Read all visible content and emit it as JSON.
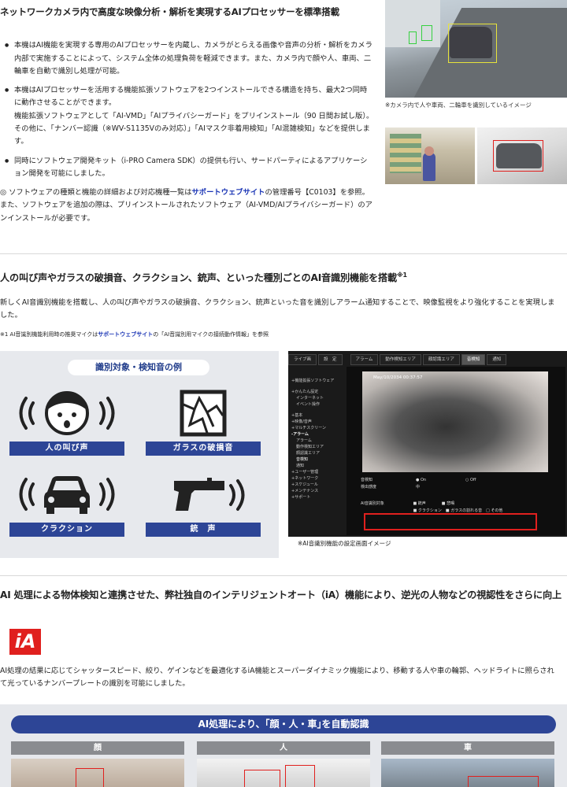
{
  "section1": {
    "title": "ネットワークカメラ内で高度な映像分析・解析を実現するAIプロセッサーを標準搭載",
    "bullets": [
      {
        "lines": [
          "本機はAI機能を実現する専用のAIプロセッサーを内蔵し、カメラがとらえる画像や音声の分析・解析をカメラ内部で実施することによって、システム全体の処理負荷を軽減できます。また、カメラ内で顔や人、車両、二輪車を自動で識別し処理が可能。"
        ]
      },
      {
        "lines": [
          "本機はAIプロセッサーを活用する機能拡張ソフトウェアを2つインストールできる構造を持ち、最大2つ同時に動作させることができます。",
          "機能拡張ソフトウェアとして「AI-VMD」「AIプライバシーガード」をプリインストール（90 日間お試し版）。",
          "その他に、「ナンバー認識（※WV-S1135Vのみ対応）」「AIマスク非着用検知」「AI混雑検知」などを提供します。"
        ]
      },
      {
        "lines": [
          "同時にソフトウェア開発キット（i-PRO Camera SDK）の提供も行い、サードパーティによるアプリケーション開発を可能にしました。"
        ]
      }
    ],
    "note_prefix": "◎ ソフトウェアの種類と機能の詳細および対応機種一覧は",
    "note_link": "サポートウェブサイト",
    "note_suffix": "の管理番号【C0103】を参照。また、ソフトウェアを追加の際は、プリインストールされたソフトウェア（AI-VMD/AIプライバシーガード）のアンインストールが必要です。",
    "photo1_caption": "※カメラ内で人や車両、二輪車を識別しているイメージ"
  },
  "section2": {
    "title": "人の叫び声やガラスの破損音、クラクション、銃声、といった種別ごとのAI音識別機能を搭載",
    "title_sup": "※1",
    "text": "新しくAI音識別機能を搭載し、人の叫び声やガラスの破損音、クラクション、銃声といった音を識別しアラーム通知することで、映像監視をより強化することを実現しました。",
    "footnote_prefix": "※1 AI音識別機能利用時の推奨マイクは",
    "footnote_link": "サポートウェブサイト",
    "footnote_suffix": "の「AI音識別用マイクの接続動作情報」を参照",
    "panel_title": "識別対象・検知音の例",
    "sounds": [
      {
        "label": "人の叫び声",
        "icon": "screaming-face-icon"
      },
      {
        "label": "ガラスの破損音",
        "icon": "broken-glass-icon"
      },
      {
        "label": "クラクション",
        "icon": "car-horn-icon"
      },
      {
        "label": "銃　声",
        "icon": "gunshot-icon"
      }
    ],
    "ui": {
      "top_tabs": [
        "ライブ画",
        "設　定",
        "アラーム",
        "動作検知エリア",
        "顔認識エリア",
        "音検知",
        "通知"
      ],
      "timestamp": "May/10/2034  00:37:57",
      "side_items": [
        "+機能拡張ソフトウェア",
        "+かんたん設定",
        "インターネット",
        "イベント操作",
        "+基本",
        "+映像/音声",
        "+マルチスクリーン",
        "-アラーム",
        "アラーム",
        "動作検知エリア",
        "顔認識エリア",
        "音検知",
        "通知",
        "+ユーザー管理",
        "+ネットワーク",
        "+スケジュール",
        "+メンテナンス",
        "+サポート"
      ],
      "rows": [
        "音検知　　　　　　　　　　　● On　　　　　　　　　　○ Off",
        "検出感度　　　　　　　　　　中",
        "AI音識別対象　　　　　　　 ■ 銃声　　　　■ 悲鳴",
        "　　　　　　　　　　　　　 ■ クラクション　■ ガラスの割れる音　□ その他"
      ]
    },
    "ui_caption": "※AI音識別機能の設定画面イメージ"
  },
  "section3": {
    "title": "AI 処理による物体検知と連携させた、弊社独自のインテリジェントオート（iA）機能により、逆光の人物などの視認性をさらに向上",
    "logo_text": "iA",
    "text": "AI処理の結果に応じてシャッタースピード、絞り、ゲインなどを最適化するiA機能とスーパーダイナミック機能により、移動する人や車の輪郭、ヘッドライトに照らされて光っているナンバープレートの識別を可能にしました。",
    "panel_title": "AI処理により、｢顔・人・車｣を自動認識",
    "columns": [
      "顔",
      "人",
      "車"
    ]
  }
}
